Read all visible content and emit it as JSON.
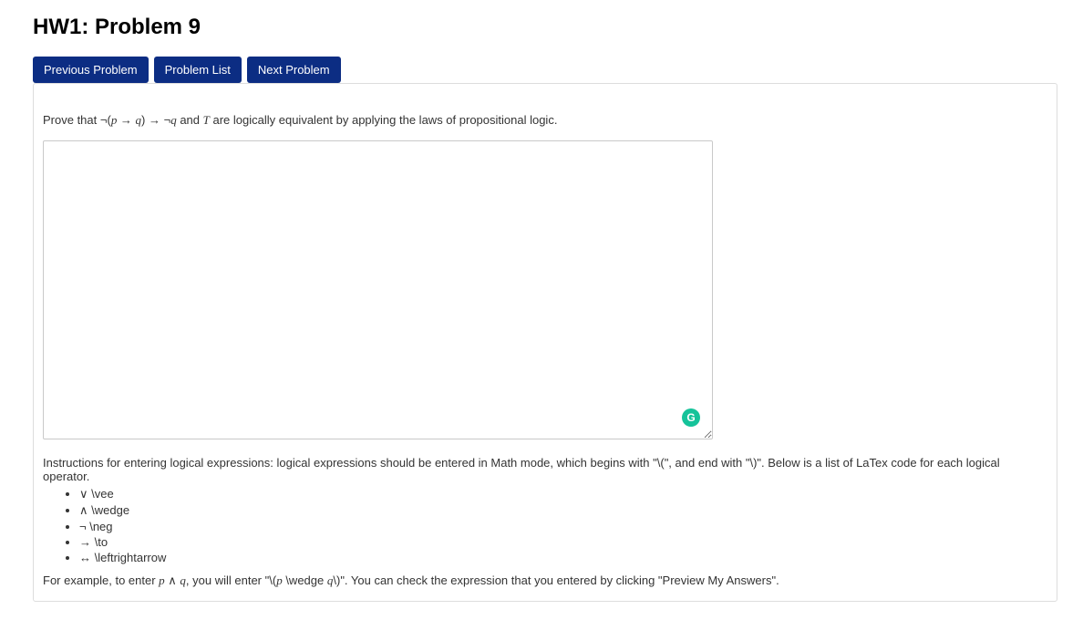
{
  "title": "HW1: Problem 9",
  "nav": {
    "prev": "Previous Problem",
    "list": "Problem List",
    "next": "Next Problem"
  },
  "prompt": {
    "pre": "Prove that ",
    "expr_neg": "¬",
    "expr_open": "(",
    "expr_p": "p",
    "expr_to1": " → ",
    "expr_q": "q",
    "expr_close": ")",
    "expr_to2": " → ",
    "expr_neg2": "¬",
    "expr_q2": "q",
    "mid": " and ",
    "expr_T": "T",
    "post": " are logically equivalent by applying the laws of propositional logic."
  },
  "answer_value": "",
  "instructions": {
    "lead": "Instructions for entering logical expressions: logical expressions should be entered in Math mode, which begins with \"\\(\", and end with \"\\)\". Below is a list of LaTex code for each logical operator.",
    "ops": [
      {
        "sym": "∨",
        "code": "\\vee"
      },
      {
        "sym": "∧",
        "code": "\\wedge"
      },
      {
        "sym": "¬",
        "code": "\\neg"
      },
      {
        "sym": "→",
        "code": "\\to"
      },
      {
        "sym": "↔",
        "code": "\\leftrightarrow"
      }
    ],
    "example_pre": "For example, to enter ",
    "example_expr_p": "p",
    "example_expr_and": " ∧ ",
    "example_expr_q": "q",
    "example_mid": ", you will enter \"",
    "example_code_open": "\\(",
    "example_code_p": "p",
    "example_code_wedge": " \\wedge ",
    "example_code_q": "q",
    "example_code_close": "\\)",
    "example_post": "\". You can check the expression that you entered by clicking \"Preview My Answers\"."
  },
  "grammarly_letter": "G"
}
